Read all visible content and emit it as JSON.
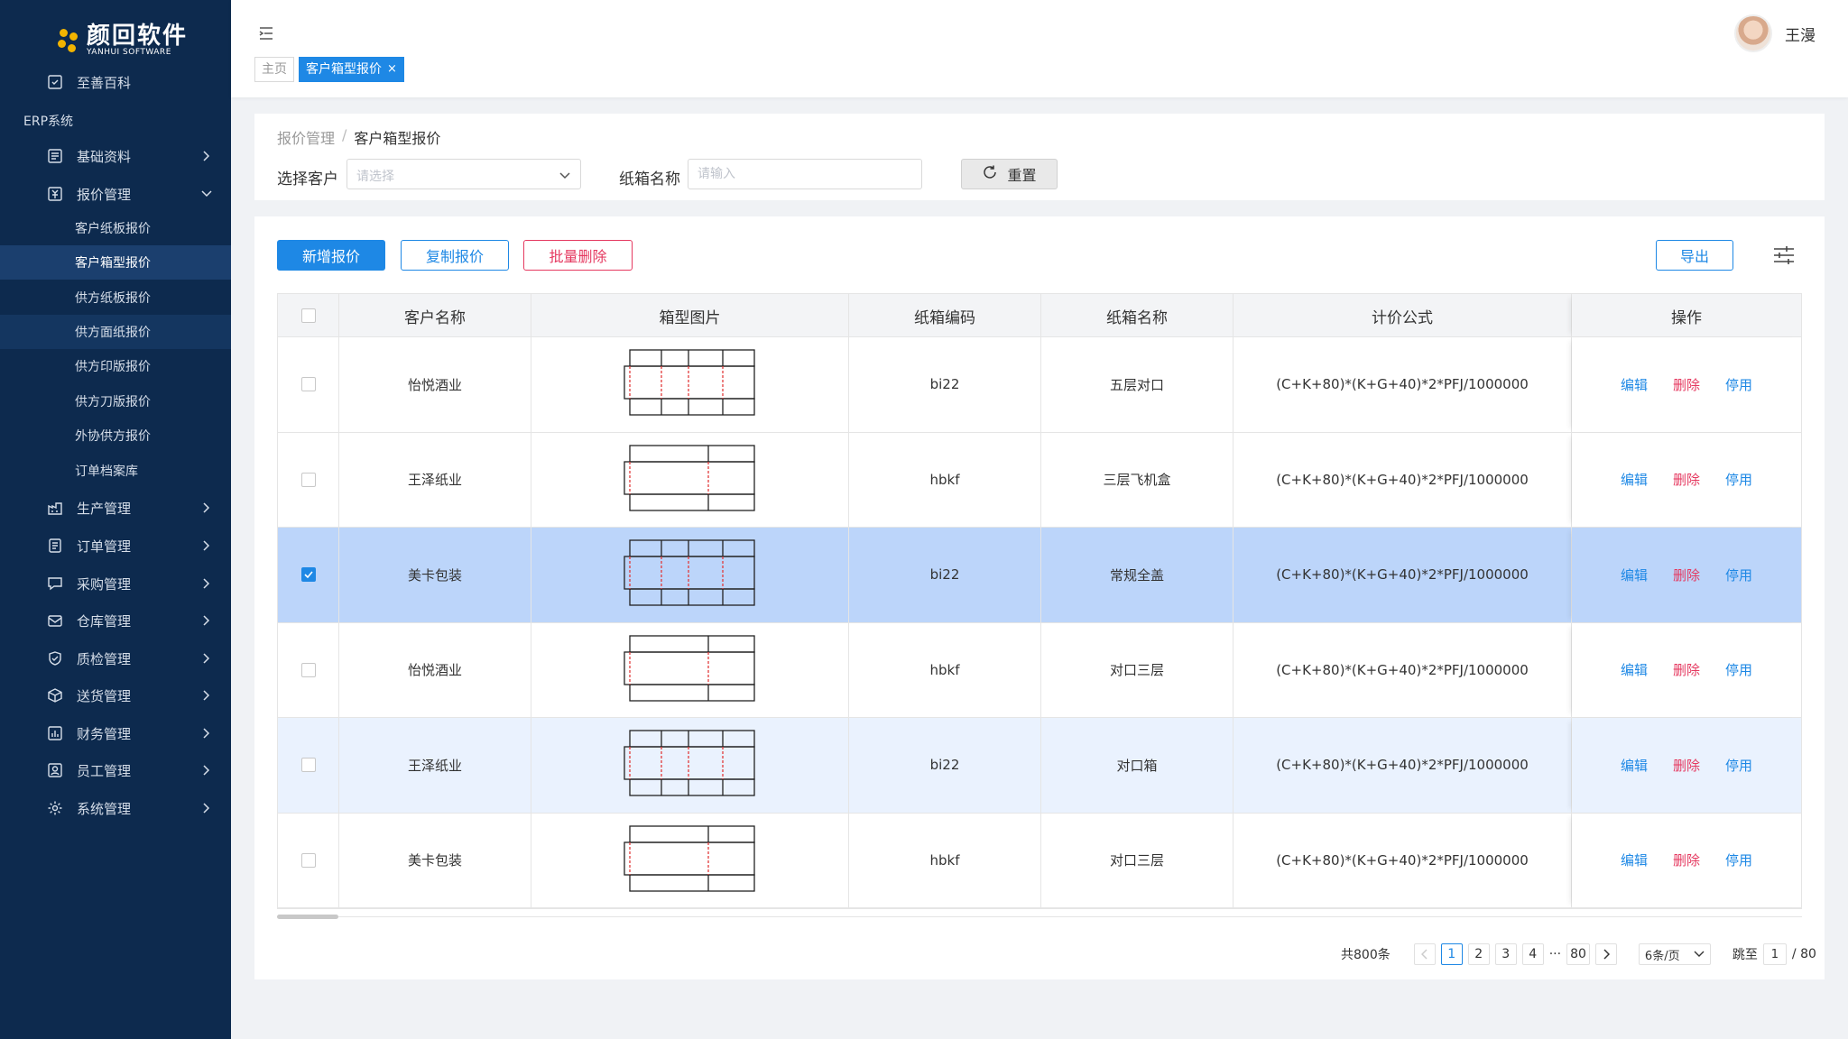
{
  "logo": {
    "name": "颜回软件",
    "subtitle": "YANHUI SOFTWARE"
  },
  "sidebar": {
    "top_item": {
      "label": "至善百科",
      "icon": "encyclopedia-icon"
    },
    "section_label": "ERP系统",
    "groups": [
      {
        "label": "基础资料",
        "icon": "document-icon"
      },
      {
        "label": "报价管理",
        "icon": "quote-icon",
        "expanded": true
      },
      {
        "label": "生产管理",
        "icon": "factory-icon"
      },
      {
        "label": "订单管理",
        "icon": "order-icon"
      },
      {
        "label": "采购管理",
        "icon": "purchase-icon"
      },
      {
        "label": "仓库管理",
        "icon": "warehouse-icon"
      },
      {
        "label": "质检管理",
        "icon": "shield-icon"
      },
      {
        "label": "送货管理",
        "icon": "box-icon"
      },
      {
        "label": "财务管理",
        "icon": "finance-icon"
      },
      {
        "label": "员工管理",
        "icon": "staff-icon"
      },
      {
        "label": "系统管理",
        "icon": "gear-icon"
      }
    ],
    "sub_items": [
      "客户纸板报价",
      "客户箱型报价",
      "供方纸板报价",
      "供方面纸报价",
      "供方印版报价",
      "供方刀版报价",
      "外协供方报价",
      "订单档案库"
    ],
    "active_sub": "客户箱型报价"
  },
  "header": {
    "tabs": [
      {
        "label": "主页"
      },
      {
        "label": "客户箱型报价",
        "close": "×"
      }
    ],
    "user_name": "王漫"
  },
  "filter": {
    "breadcrumb_parent": "报价管理",
    "breadcrumb_sep": "/",
    "breadcrumb_current": "客户箱型报价",
    "customer_label": "选择客户",
    "customer_placeholder": "请选择",
    "box_name_label": "纸箱名称",
    "box_name_placeholder": "请输入",
    "reset_label": "重置"
  },
  "toolbar": {
    "add_label": "新增报价",
    "copy_label": "复制报价",
    "batch_delete_label": "批量删除",
    "export_label": "导出"
  },
  "table": {
    "columns": [
      "客户名称",
      "箱型图片",
      "纸箱编码",
      "纸箱名称",
      "计价公式",
      "操作"
    ],
    "action_labels": {
      "edit": "编辑",
      "delete": "删除",
      "disable": "停用"
    },
    "rows": [
      {
        "customer": "怡悦酒业",
        "image": "rsc-box-diagram",
        "code": "bi22",
        "name": "五层对口",
        "formula": "(C+K+80)*(K+G+40)*2*PFJ/1000000",
        "checked": false
      },
      {
        "customer": "王泽纸业",
        "image": "two-panel-box-diagram",
        "code": "hbkf",
        "name": "三层飞机盒",
        "formula": "(C+K+80)*(K+G+40)*2*PFJ/1000000",
        "checked": false
      },
      {
        "customer": "美卡包装",
        "image": "rsc-box-diagram",
        "code": "bi22",
        "name": "常规全盖",
        "formula": "(C+K+80)*(K+G+40)*2*PFJ/1000000",
        "checked": true
      },
      {
        "customer": "怡悦酒业",
        "image": "two-panel-box-diagram",
        "code": "hbkf",
        "name": "对口三层",
        "formula": "(C+K+80)*(K+G+40)*2*PFJ/1000000",
        "checked": false
      },
      {
        "customer": "王泽纸业",
        "image": "rsc-box-diagram",
        "code": "bi22",
        "name": "对口箱",
        "formula": "(C+K+80)*(K+G+40)*2*PFJ/1000000",
        "checked": false
      },
      {
        "customer": "美卡包装",
        "image": "two-panel-box-diagram",
        "code": "hbkf",
        "name": "对口三层",
        "formula": "(C+K+80)*(K+G+40)*2*PFJ/1000000",
        "checked": false
      }
    ]
  },
  "pagination": {
    "total_text": "共800条",
    "pages": [
      "1",
      "2",
      "3",
      "4"
    ],
    "ellipsis": "···",
    "last_page": "80",
    "current_page": "1",
    "page_size": "6条/页",
    "jump_label": "跳至",
    "jump_value": "1",
    "total_pages_text": "/ 80"
  },
  "colors": {
    "sidebar_bg": "#0d2a4e",
    "primary": "#1e88e5",
    "danger": "#e53960",
    "selected_row": "#bcd5fa",
    "hover_row": "#eaf2fe"
  }
}
